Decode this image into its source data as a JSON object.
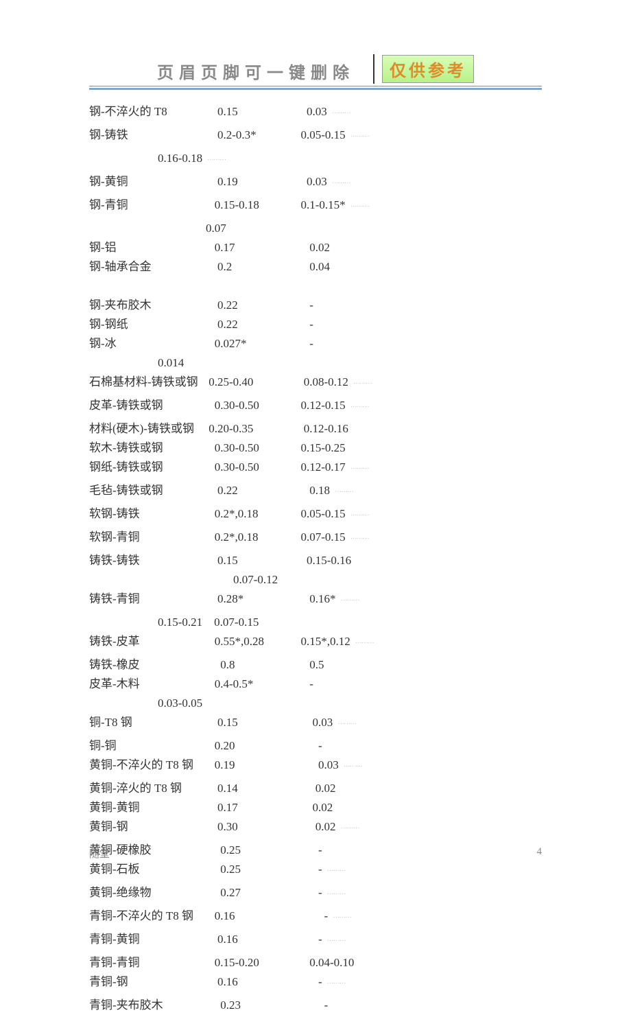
{
  "header": {
    "title": "页眉页脚可一键删除",
    "badge": "仅供参考"
  },
  "rows": [
    {
      "type": "row",
      "c1": "钢-不淬火的 T8",
      "c2": "    0.15",
      "c3": "    0.03",
      "dots": true
    },
    {
      "type": "row",
      "c1": "钢-铸铁",
      "c2": "    0.2-0.3*",
      "c3": "  0.05-0.15",
      "dots": true
    },
    {
      "type": "cont",
      "cls": "indent-a",
      "text": "0.16-0.18",
      "dots": true
    },
    {
      "type": "row",
      "c1": "钢-黄铜",
      "c2": "    0.19",
      "c3": "    0.03",
      "dots": true
    },
    {
      "type": "row",
      "c1": "钢-青铜",
      "c2": "   0.15-0.18",
      "c3": "  0.1-0.15*",
      "dots": true
    },
    {
      "type": "cont",
      "cls": "indent-b",
      "text": "0.07"
    },
    {
      "type": "row",
      "c1": "钢-铝",
      "c2": "   0.17",
      "c3": "     0.02"
    },
    {
      "type": "row",
      "c1": "钢-轴承合金",
      "c2": "    0.2",
      "c3": "     0.04"
    },
    {
      "type": "blank"
    },
    {
      "type": "row",
      "c1": "钢-夹布胶木",
      "c2": "    0.22",
      "c3": "     -"
    },
    {
      "type": "row",
      "c1": "钢-钢纸",
      "c2": "    0.22",
      "c3": "     -"
    },
    {
      "type": "row",
      "c1": "钢-冰",
      "c2": "   0.027*",
      "c3": "     -"
    },
    {
      "type": "cont",
      "cls": "indent-a",
      "text": "0.014"
    },
    {
      "type": "row",
      "c1": "石棉基材料-铸铁或钢",
      "c2": " 0.25-0.40",
      "c3": "   0.08-0.12",
      "dots": true
    },
    {
      "type": "row",
      "c1": "皮革-铸铁或钢",
      "c2": "   0.30-0.50",
      "c3": "  0.12-0.15",
      "dots": true
    },
    {
      "type": "row",
      "c1": "材料(硬木)-铸铁或钢",
      "c2": " 0.20-0.35",
      "c3": "   0.12-0.16"
    },
    {
      "type": "row",
      "c1": "软木-铸铁或钢",
      "c2": "   0.30-0.50",
      "c3": "  0.15-0.25"
    },
    {
      "type": "row",
      "c1": "钢纸-铸铁或钢",
      "c2": "   0.30-0.50",
      "c3": "  0.12-0.17",
      "dots": true
    },
    {
      "type": "row",
      "c1": "毛毡-铸铁或钢",
      "c2": "    0.22",
      "c3": "     0.18",
      "dots": true
    },
    {
      "type": "row",
      "c1": "软钢-铸铁",
      "c2": "   0.2*,0.18",
      "c3": "  0.05-0.15",
      "dots": true
    },
    {
      "type": "row",
      "c1": "软钢-青铜",
      "c2": "   0.2*,0.18",
      "c3": "  0.07-0.15",
      "dots": true
    },
    {
      "type": "row",
      "c1": "铸铁-铸铁",
      "c2": "    0.15",
      "c3": "    0.15-0.16"
    },
    {
      "type": "cont",
      "cls": "indent-c",
      "text": "0.07-0.12"
    },
    {
      "type": "row",
      "c1": "铸铁-青铜",
      "c2": "    0.28*",
      "c3": "     0.16*",
      "dots": true
    },
    {
      "type": "cont",
      "cls": "indent-a",
      "text": "0.15-0.21    0.07-0.15"
    },
    {
      "type": "row",
      "c1": "铸铁-皮革",
      "c2": "   0.55*,0.28",
      "c3": "  0.15*,0.12",
      "dots": true
    },
    {
      "type": "row",
      "c1": "铸铁-橡皮",
      "c2": "     0.8",
      "c3": "     0.5"
    },
    {
      "type": "row",
      "c1": "皮革-木料",
      "c2": "   0.4-0.5*",
      "c3": "     -"
    },
    {
      "type": "cont",
      "cls": "indent-a",
      "text": "0.03-0.05"
    },
    {
      "type": "row",
      "c1": "铜-T8 钢",
      "c2": "    0.15",
      "c3": "      0.03",
      "dots": true
    },
    {
      "type": "row",
      "c1": "铜-铜",
      "c2": "   0.20",
      "c3": "        -"
    },
    {
      "type": "row",
      "c1": "黄铜-不淬火的 T8 钢",
      "c2": "   0.19",
      "c3": "        0.03",
      "dots": true
    },
    {
      "type": "row",
      "c1": "黄铜-淬火的 T8 钢",
      "c2": "    0.14",
      "c3": "       0.02"
    },
    {
      "type": "row",
      "c1": "黄铜-黄铜",
      "c2": "    0.17",
      "c3": "      0.02"
    },
    {
      "type": "row",
      "c1": "黄铜-钢",
      "c2": "    0.30",
      "c3": "       0.02",
      "dots": true
    },
    {
      "type": "row",
      "c1": "黄铜-硬橡胶",
      "c2": "     0.25",
      "c3": "        -"
    },
    {
      "type": "row",
      "c1": "黄铜-石板",
      "c2": "     0.25",
      "c3": "        -",
      "dots": true
    },
    {
      "type": "row",
      "c1": "黄铜-绝缘物",
      "c2": "     0.27",
      "c3": "        -",
      "dots": true
    },
    {
      "type": "row",
      "c1": "青铜-不淬火的 T8 钢",
      "c2": "   0.16",
      "c3": "          -",
      "dots": true
    },
    {
      "type": "row",
      "c1": "青铜-黄铜",
      "c2": "    0.16",
      "c3": "        -",
      "dots": true
    },
    {
      "type": "row",
      "c1": "青铜-青铜",
      "c2": "   0.15-0.20",
      "c3": "     0.04-0.10"
    },
    {
      "type": "row",
      "c1": "青铜-钢",
      "c2": "    0.16",
      "c3": "        -",
      "dots": true
    },
    {
      "type": "row",
      "c1": "青铜-夹布胶木",
      "c2": "     0.23",
      "c3": "          -"
    }
  ],
  "footer": {
    "left": "随堂",
    "right": "4"
  }
}
